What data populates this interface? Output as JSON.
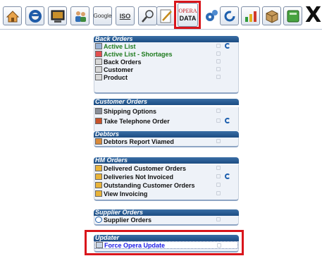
{
  "toolbar": {
    "buttons": [
      {
        "name": "home-icon",
        "type": "svg"
      },
      {
        "name": "telephone-icon",
        "type": "svg"
      },
      {
        "name": "terminal-icon",
        "type": "svg"
      },
      {
        "name": "users-icon",
        "type": "svg"
      },
      {
        "name": "google-maps-icon",
        "type": "text",
        "text": "Google"
      },
      {
        "name": "iso-icon",
        "type": "text",
        "text": "ISO"
      },
      {
        "name": "magnifier-icon",
        "type": "svg"
      },
      {
        "name": "pencil-icon",
        "type": "svg"
      }
    ],
    "opera_data": {
      "line1": "OPERA",
      "line2": "DATA",
      "selected": true
    },
    "right_buttons": [
      "gears-icon",
      "refresh-icon",
      "chart-icon",
      "box-icon",
      "book-icon"
    ],
    "close_glyph": "X"
  },
  "panels": [
    {
      "title": "Back Orders",
      "items": [
        {
          "label": "Active List",
          "color": "green",
          "icon": "list-icon",
          "refresh": true
        },
        {
          "label": "Active List - Shortages",
          "color": "green",
          "icon": "warning-list-icon",
          "refresh": false
        },
        {
          "label": "Back Orders",
          "color": "black",
          "icon": "keyboard-icon",
          "refresh": false
        },
        {
          "label": "Customer",
          "color": "black",
          "icon": "keyboard-icon",
          "refresh": false
        },
        {
          "label": "Product",
          "color": "black",
          "icon": "keyboard-icon",
          "refresh": false
        }
      ]
    },
    {
      "title": "Customer Orders",
      "items": [
        {
          "label": "Shipping Options",
          "color": "black",
          "icon": "truck-icon",
          "refresh": false
        },
        {
          "label": "Take Telephone Order",
          "color": "black",
          "icon": "phone-order-icon",
          "refresh": true
        }
      ]
    },
    {
      "title": "Debtors",
      "items": [
        {
          "label": "Debtors Report Viamed",
          "color": "black",
          "icon": "report-icon",
          "refresh": false
        }
      ]
    },
    {
      "title": "HM Orders",
      "items": [
        {
          "label": "Delivered Customer Orders",
          "color": "black",
          "icon": "pencil-note-icon",
          "refresh": false
        },
        {
          "label": "Deliveries Not Invoiced",
          "color": "black",
          "icon": "pencil-note-icon",
          "refresh": true
        },
        {
          "label": "Outstanding Customer Orders",
          "color": "black",
          "icon": "pencil-note-icon",
          "refresh": false
        },
        {
          "label": "View Invoicing",
          "color": "black",
          "icon": "pencil-note-icon",
          "refresh": false
        }
      ]
    },
    {
      "title": "Supplier Orders",
      "items": [
        {
          "label": "Supplier Orders",
          "color": "black",
          "icon": "refresh-small-icon",
          "refresh": false
        }
      ]
    },
    {
      "title": "Updater",
      "items": [
        {
          "label": "Force Opera Update",
          "color": "blue",
          "icon": "update-icon",
          "refresh": false,
          "selected": true
        }
      ]
    }
  ],
  "colors": {
    "panel_header": "#1f4f86",
    "panel_body": "#eef2f8",
    "highlight": "#d9151b",
    "green_label": "#1e7b1e",
    "blue_label": "#1a1ae6",
    "refresh": "#1d5fae"
  }
}
